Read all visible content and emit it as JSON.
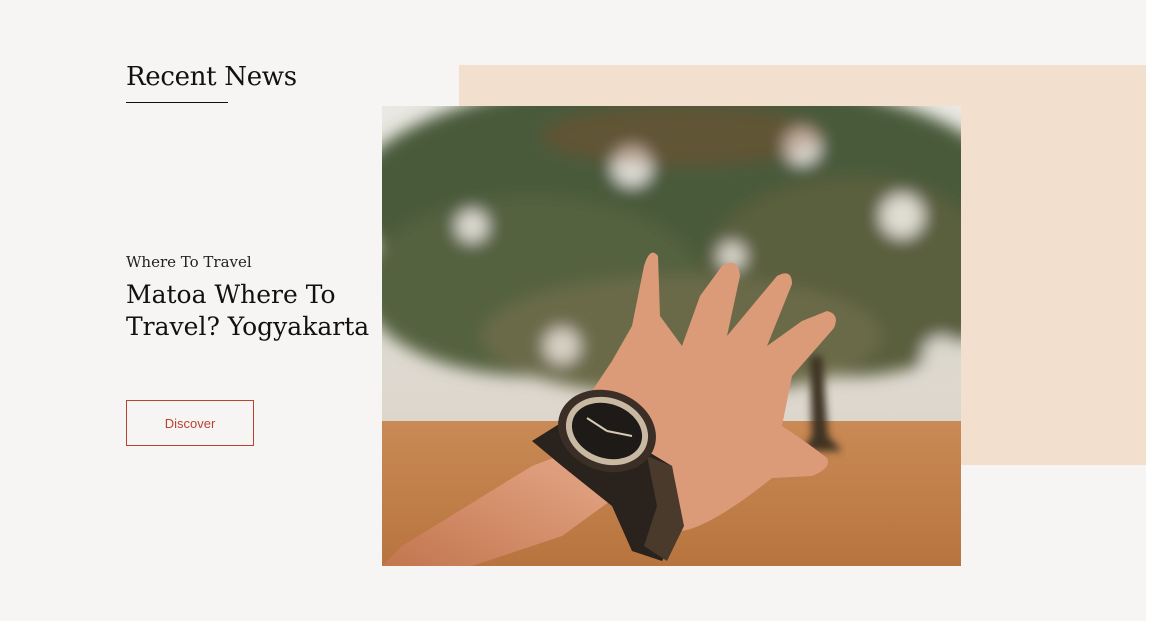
{
  "section": {
    "title": "Recent News"
  },
  "article": {
    "category": "Where To Travel",
    "headline": "Matoa Where To Travel? Yogyakarta",
    "cta_label": "Discover"
  },
  "colors": {
    "background": "#f7f5f3",
    "accent_block": "#f2dfcd",
    "button_accent": "#b8432f",
    "text": "#111111"
  }
}
